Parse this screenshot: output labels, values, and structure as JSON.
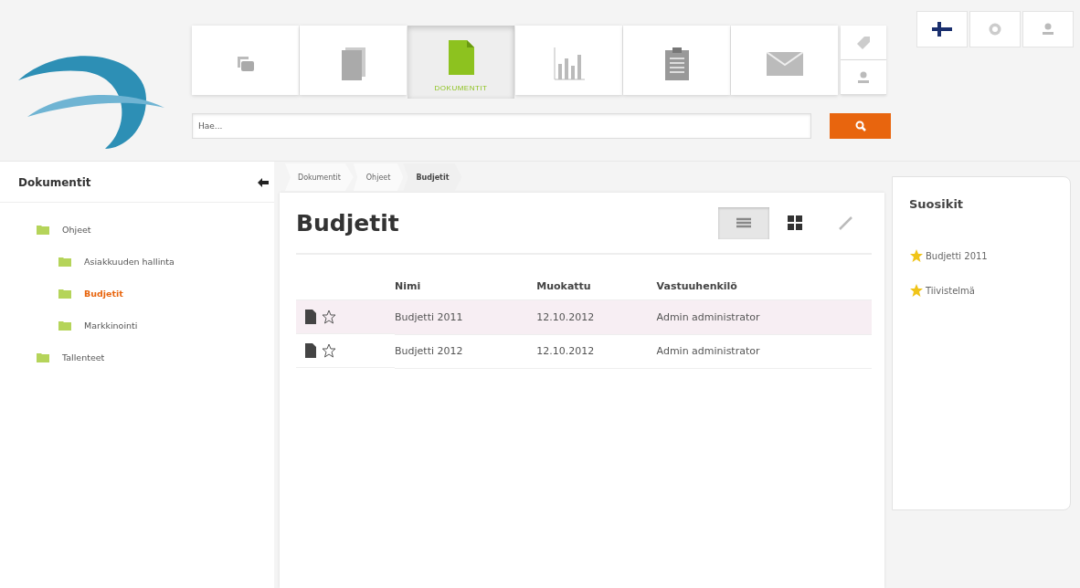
{
  "header": {
    "tabs": [
      {
        "kind": "stack",
        "selected": false
      },
      {
        "kind": "pages",
        "selected": false
      },
      {
        "kind": "document",
        "label": "DOKUMENTIT",
        "selected": true
      },
      {
        "kind": "chart",
        "selected": false
      },
      {
        "kind": "clipboard",
        "selected": false
      },
      {
        "kind": "mail",
        "selected": false
      }
    ],
    "search": {
      "placeholder": "Hae..."
    }
  },
  "sidebar": {
    "title": "Dokumentit",
    "tree": [
      {
        "label": "Ohjeet",
        "selected": false,
        "children": [
          {
            "label": "Asiakkuuden hallinta",
            "selected": false
          },
          {
            "label": "Budjetit",
            "selected": true
          },
          {
            "label": "Markkinointi",
            "selected": false
          }
        ]
      },
      {
        "label": "Tallenteet",
        "selected": false
      }
    ]
  },
  "breadcrumb": [
    {
      "label": "Dokumentit",
      "selected": false
    },
    {
      "label": "Ohjeet",
      "selected": false
    },
    {
      "label": "Budjetit",
      "selected": true
    }
  ],
  "main": {
    "title": "Budjetit",
    "views": [
      {
        "kind": "list",
        "selected": true
      },
      {
        "kind": "grid",
        "selected": false
      },
      {
        "kind": "edit",
        "selected": false
      }
    ],
    "table": {
      "columns": [
        "Nimi",
        "Muokattu",
        "Vastuuhenkilö"
      ],
      "rows": [
        {
          "selected": true,
          "favorite": false,
          "cells": [
            "Budjetti 2011",
            "12.10.2012",
            "Admin administrator"
          ]
        },
        {
          "selected": false,
          "favorite": false,
          "cells": [
            "Budjetti 2012",
            "12.10.2012",
            "Admin administrator"
          ]
        }
      ]
    }
  },
  "favorites": {
    "title": "Suosikit",
    "items": [
      "Budjetti 2011",
      "Tiivistelmä"
    ]
  }
}
